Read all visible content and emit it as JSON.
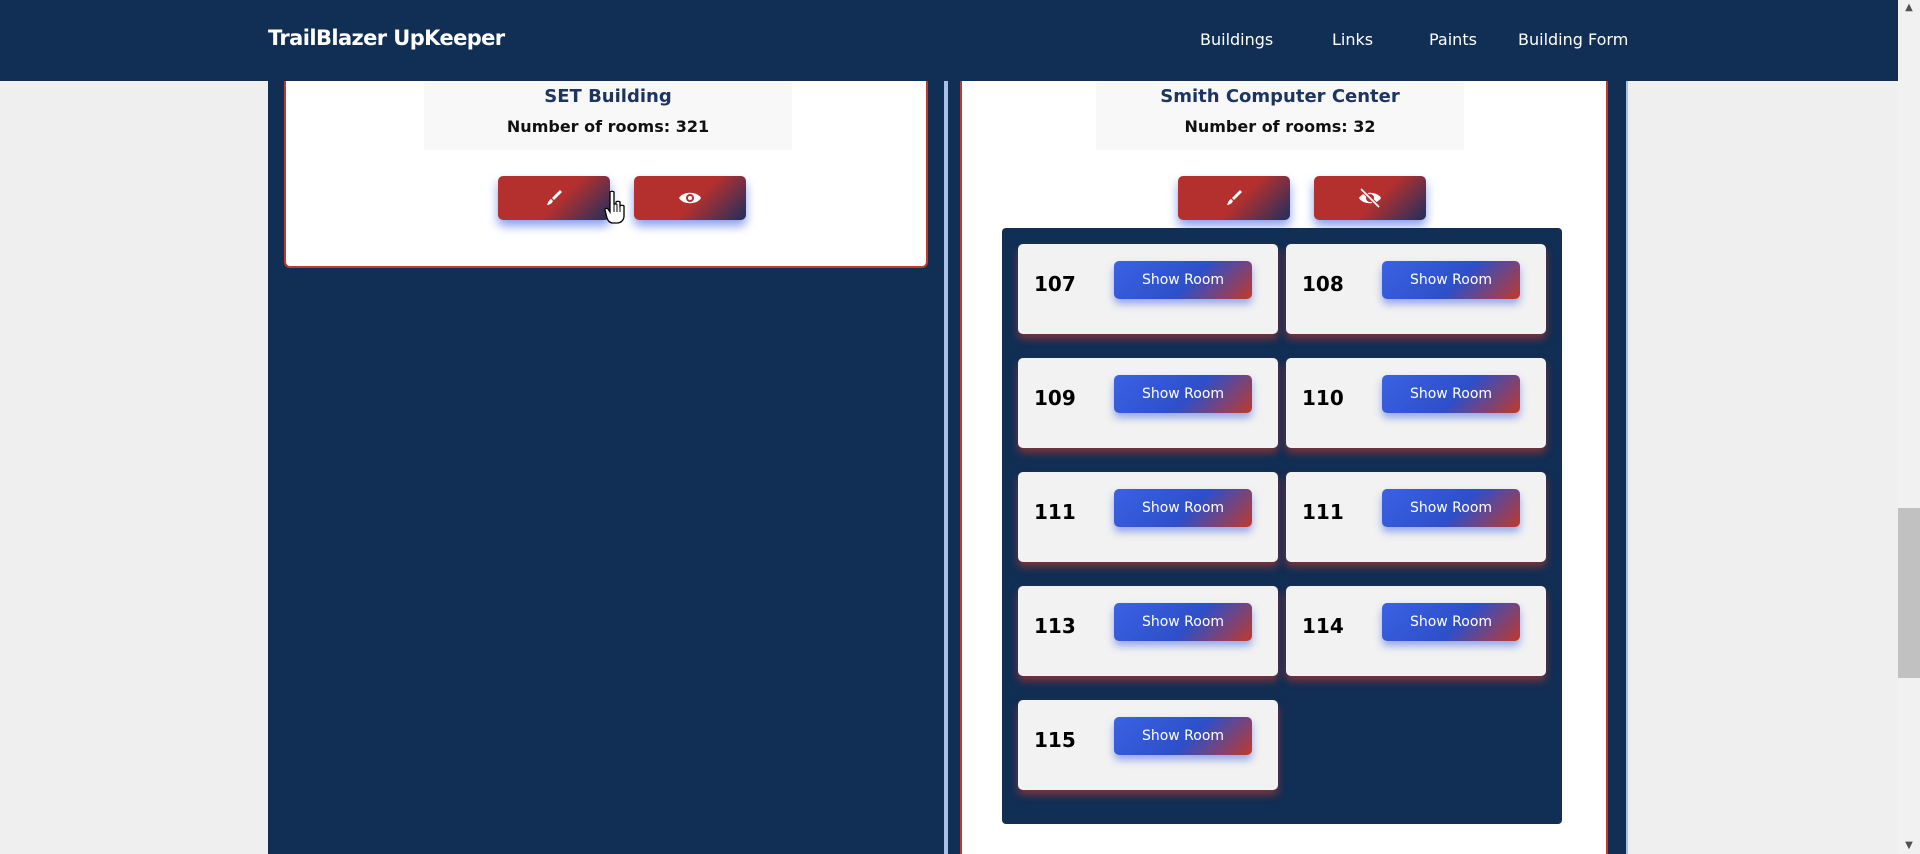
{
  "nav": {
    "brand": "TrailBlazer UpKeeper",
    "links": [
      "Buildings",
      "Links",
      "Paints",
      "Building Form"
    ]
  },
  "buildings": [
    {
      "name": "SET Building",
      "rooms_label": "Number of rooms: 321",
      "visibility": "shown"
    },
    {
      "name": "Smith Computer Center",
      "rooms_label": "Number of rooms: 32",
      "visibility": "hidden",
      "rooms": [
        {
          "number": "107",
          "action": "Show Room"
        },
        {
          "number": "108",
          "action": "Show Room"
        },
        {
          "number": "109",
          "action": "Show Room"
        },
        {
          "number": "110",
          "action": "Show Room"
        },
        {
          "number": "111",
          "action": "Show Room"
        },
        {
          "number": "111",
          "action": "Show Room"
        },
        {
          "number": "113",
          "action": "Show Room"
        },
        {
          "number": "114",
          "action": "Show Room"
        },
        {
          "number": "115",
          "action": "Show Room"
        }
      ]
    }
  ],
  "icons": {
    "edit": "paintbrush-icon",
    "view": "eye-icon",
    "hide": "eye-slash-icon"
  },
  "colors": {
    "navbar": "#112e54",
    "accent_red": "#b3302e",
    "accent_blue": "#3a62e4"
  }
}
